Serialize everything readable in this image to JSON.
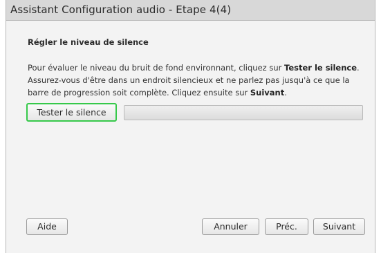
{
  "window": {
    "title": "Assistant Configuration audio - Etape 4(4)"
  },
  "section": {
    "heading": "Régler le niveau de silence"
  },
  "description": {
    "part1": "Pour évaluer le niveau du bruit de fond environnant, cliquez sur ",
    "bold1": "Tester le silence",
    "part2": ". Assurez-vous d'être dans un endroit silencieux et ne parlez pas jusqu'à ce que la barre de progression soit complète. Cliquez ensuite sur ",
    "bold2": "Suivant",
    "part3": "."
  },
  "test_button": {
    "label": "Tester le silence",
    "focus_color": "#36c94a"
  },
  "progress": {
    "value_percent": 0
  },
  "footer": {
    "help_label": "Aide",
    "cancel_label": "Annuler",
    "prev_label": "Préc.",
    "next_label": "Suivant"
  }
}
